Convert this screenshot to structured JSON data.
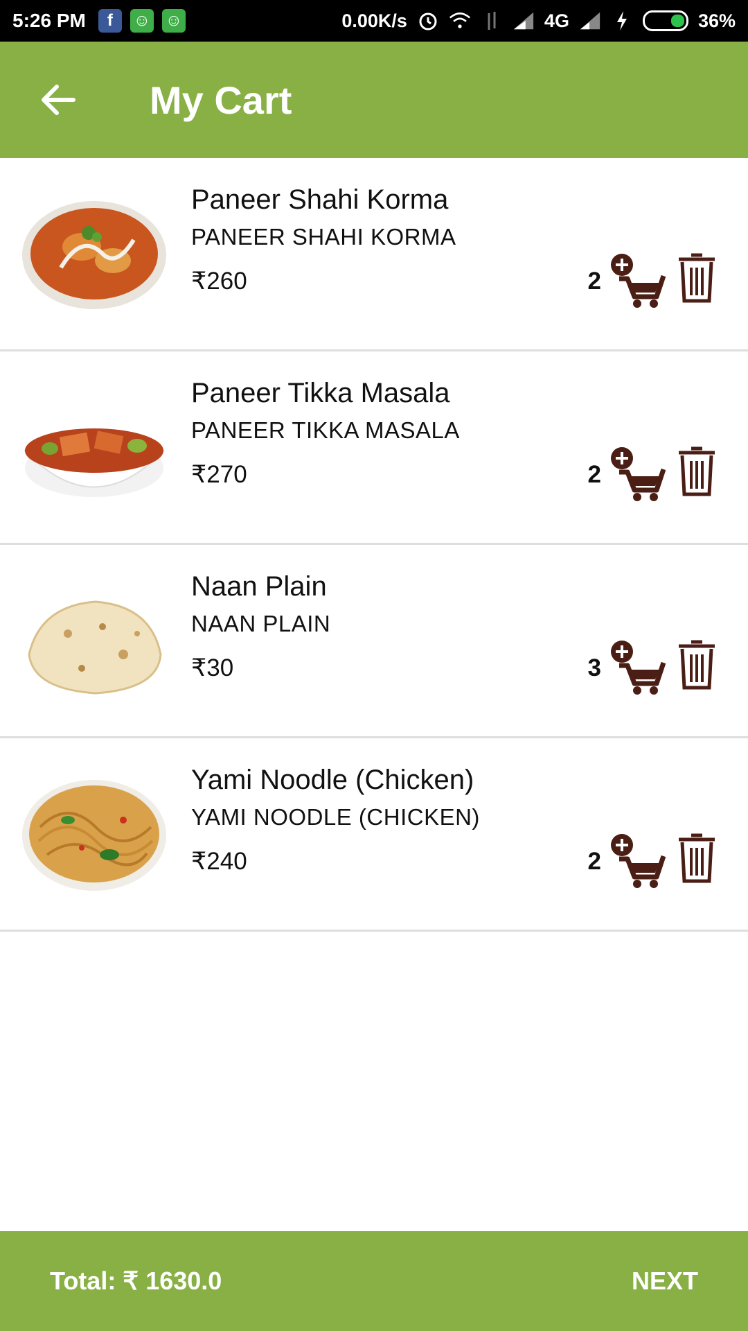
{
  "status_bar": {
    "time": "5:26 PM",
    "network_speed": "0.00K/s",
    "network_type": "4G",
    "battery": "36%",
    "app_icons": [
      "facebook-icon",
      "app-bot-icon",
      "app-bot-icon"
    ]
  },
  "app_bar": {
    "title": "My Cart",
    "back_icon": "arrow-left-icon"
  },
  "colors": {
    "primary": "#88b044",
    "icon_brown": "#4a1e14",
    "divider": "#dedede"
  },
  "cart": {
    "items": [
      {
        "name": "Paneer Shahi Korma",
        "subtitle": "PANEER SHAHI KORMA",
        "price": "₹260",
        "qty": "2",
        "image": "paneer-shahi-korma-image"
      },
      {
        "name": "Paneer Tikka Masala",
        "subtitle": "PANEER TIKKA MASALA",
        "price": "₹270",
        "qty": "2",
        "image": "paneer-tikka-masala-image"
      },
      {
        "name": "Naan Plain",
        "subtitle": "NAAN PLAIN",
        "price": "₹30",
        "qty": "3",
        "image": "naan-plain-image"
      },
      {
        "name": "Yami Noodle (Chicken)",
        "subtitle": "YAMI NOODLE (CHICKEN)",
        "price": "₹240",
        "qty": "2",
        "image": "yami-noodle-image"
      }
    ]
  },
  "footer": {
    "total": "Total: ₹ 1630.0",
    "next": "NEXT"
  }
}
